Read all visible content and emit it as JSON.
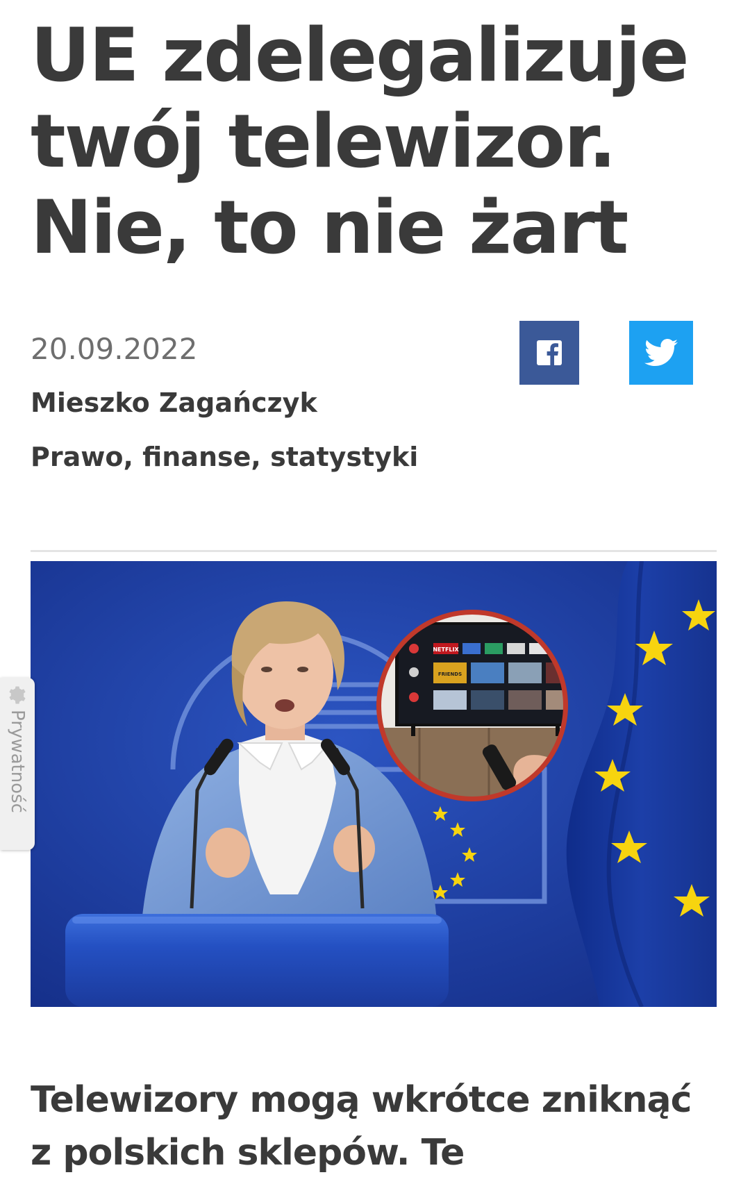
{
  "article": {
    "title": "UE zdelegalizuje twój telewizor. Nie, to nie żart",
    "date": "20.09.2022",
    "author": "Mieszko Zagańczyk",
    "category": "Prawo, finanse, statystyki",
    "lead": "Telewizory mogą wkrótce zniknąć z polskich sklepów. Te"
  },
  "share": {
    "facebook_icon": "facebook-icon",
    "twitter_icon": "twitter-icon"
  },
  "privacy_tab": {
    "label": "Prywatność",
    "icon": "gear-icon"
  },
  "tv_screen": {
    "tiles": [
      "NETFLIX",
      "FRIENDS"
    ]
  },
  "colors": {
    "facebook": "#3b5998",
    "twitter": "#1da1f2",
    "eu_blue": "#1f3f9e",
    "eu_star": "#f7d40f"
  }
}
